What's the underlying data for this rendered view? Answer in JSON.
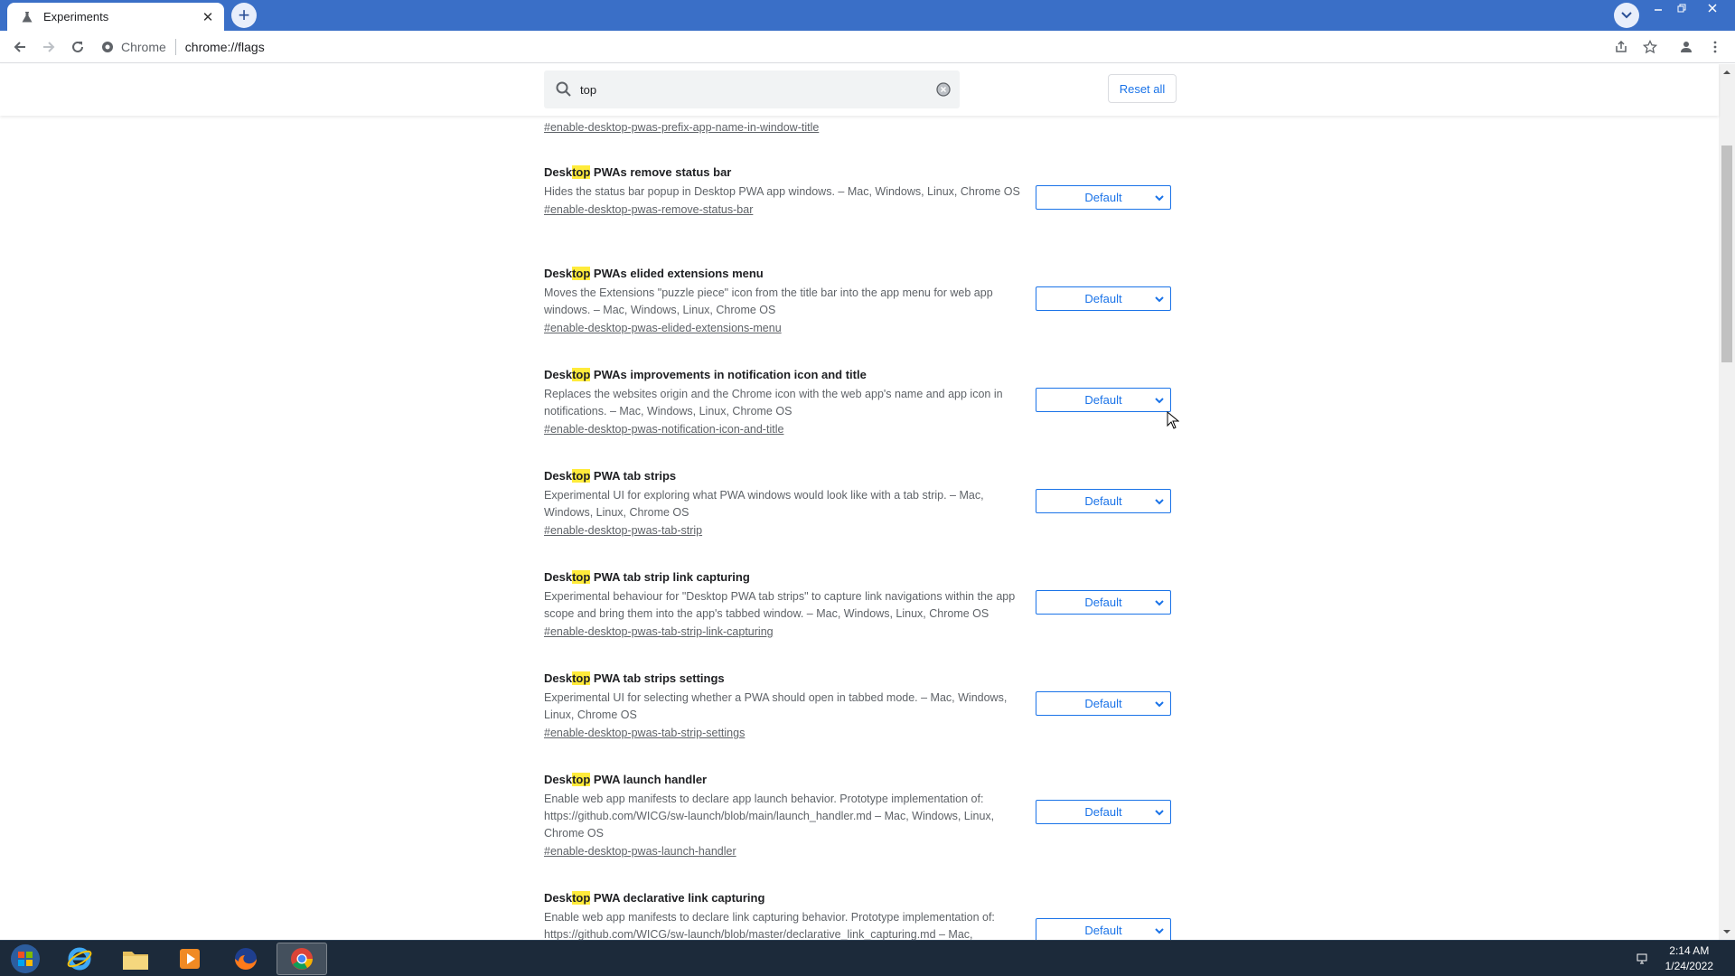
{
  "browser": {
    "tab_title": "Experiments",
    "new_tab_label": "+",
    "omnibox_chip": "Chrome",
    "url": "chrome://flags"
  },
  "search": {
    "value": "top",
    "reset_label": "Reset all"
  },
  "partial_flag_link": "#enable-desktop-pwas-prefix-app-name-in-window-title",
  "highlight_color": "#ffeb3b",
  "flags": [
    {
      "name_pre": "Desk",
      "name_hl": "top",
      "name_post": " PWAs remove status bar",
      "desc": "Hides the status bar popup in Desktop PWA app windows. – Mac, Windows, Linux, Chrome OS",
      "link": "#enable-desktop-pwas-remove-status-bar",
      "value": "Default"
    },
    {
      "name_pre": "Desk",
      "name_hl": "top",
      "name_post": " PWAs elided extensions menu",
      "desc": "Moves the Extensions \"puzzle piece\" icon from the title bar into the app menu for web app windows. – Mac, Windows, Linux, Chrome OS",
      "link": "#enable-desktop-pwas-elided-extensions-menu",
      "value": "Default"
    },
    {
      "name_pre": "Desk",
      "name_hl": "top",
      "name_post": " PWAs improvements in notification icon and title",
      "desc": "Replaces the websites origin and the Chrome icon with the web app's name and app icon in notifications. – Mac, Windows, Linux, Chrome OS",
      "link": "#enable-desktop-pwas-notification-icon-and-title",
      "value": "Default"
    },
    {
      "name_pre": "Desk",
      "name_hl": "top",
      "name_post": " PWA tab strips",
      "desc": "Experimental UI for exploring what PWA windows would look like with a tab strip. – Mac, Windows, Linux, Chrome OS",
      "link": "#enable-desktop-pwas-tab-strip",
      "value": "Default"
    },
    {
      "name_pre": "Desk",
      "name_hl": "top",
      "name_post": " PWA tab strip link capturing",
      "desc": "Experimental behaviour for \"Desktop PWA tab strips\" to capture link navigations within the app scope and bring them into the app's tabbed window. – Mac, Windows, Linux, Chrome OS",
      "link": "#enable-desktop-pwas-tab-strip-link-capturing",
      "value": "Default"
    },
    {
      "name_pre": "Desk",
      "name_hl": "top",
      "name_post": " PWA tab strips settings",
      "desc": "Experimental UI for selecting whether a PWA should open in tabbed mode. – Mac, Windows, Linux, Chrome OS",
      "link": "#enable-desktop-pwas-tab-strip-settings",
      "value": "Default"
    },
    {
      "name_pre": "Desk",
      "name_hl": "top",
      "name_post": " PWA launch handler",
      "desc": "Enable web app manifests to declare app launch behavior. Prototype implementation of: https://github.com/WICG/sw-launch/blob/main/launch_handler.md – Mac, Windows, Linux, Chrome OS",
      "link": "#enable-desktop-pwas-launch-handler",
      "value": "Default"
    },
    {
      "name_pre": "Desk",
      "name_hl": "top",
      "name_post": " PWA declarative link capturing",
      "desc": "Enable web app manifests to declare link capturing behavior. Prototype implementation of: https://github.com/WICG/sw-launch/blob/master/declarative_link_capturing.md – Mac,",
      "link": "",
      "value": "Default"
    }
  ],
  "taskbar": {
    "time": "2:14 AM",
    "date": "1/24/2022"
  }
}
